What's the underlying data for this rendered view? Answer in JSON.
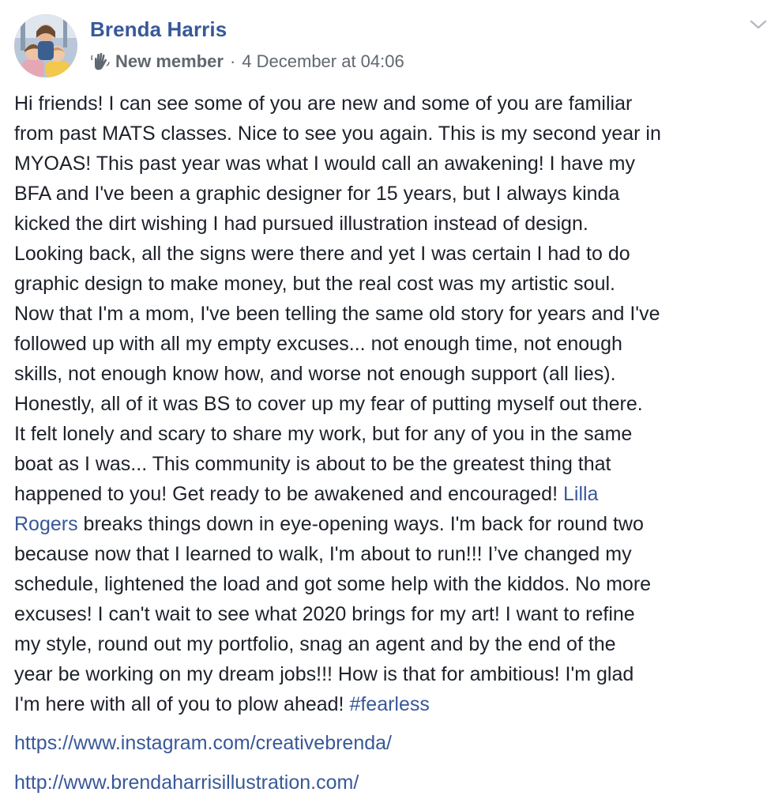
{
  "post": {
    "author": {
      "name": "Brenda Harris",
      "avatar_icon": "profile-photo"
    },
    "meta": {
      "badge_icon": "waving-hand-icon",
      "badge_label": "New member",
      "separator": "·",
      "timestamp": "4 December at 04:06"
    },
    "menu_icon": "chevron-down-icon",
    "lines": [
      {
        "segments": [
          {
            "t": "Hi friends! I can see some of you are new and some of you are familiar"
          }
        ]
      },
      {
        "segments": [
          {
            "t": "from past MATS classes. Nice to see you again. This is my second year in"
          }
        ]
      },
      {
        "segments": [
          {
            "t": "MYOAS! This past year was what I would call an awakening! I have my"
          }
        ]
      },
      {
        "segments": [
          {
            "t": "BFA and I've been a graphic designer for 15 years, but I always kinda"
          }
        ]
      },
      {
        "segments": [
          {
            "t": "kicked the dirt wishing I had pursued illustration instead of design."
          }
        ]
      },
      {
        "segments": [
          {
            "t": "Looking back, all the signs were there and yet I was certain I had to do"
          }
        ]
      },
      {
        "segments": [
          {
            "t": "graphic design to make money, but the real cost was my artistic soul."
          }
        ]
      },
      {
        "segments": [
          {
            "t": "Now that I'm a mom, I've been telling the same old story for years and I've"
          }
        ]
      },
      {
        "segments": [
          {
            "t": "followed up with all my empty excuses... not enough time, not enough"
          }
        ]
      },
      {
        "segments": [
          {
            "t": "skills, not enough know how, and worse not enough support (all lies)."
          }
        ]
      },
      {
        "segments": [
          {
            "t": "Honestly, all of it was BS to cover up my fear of putting myself out there."
          }
        ]
      },
      {
        "segments": [
          {
            "t": "It felt lonely and scary to share my work, but for any of you in the same"
          }
        ]
      },
      {
        "segments": [
          {
            "t": "boat as I was... This community is about to be the greatest thing that"
          }
        ]
      },
      {
        "segments": [
          {
            "t": "happened to you! Get ready to be awakened and encouraged! "
          },
          {
            "t": "Lilla",
            "link": true,
            "name": "mention-lilla-rogers"
          }
        ]
      },
      {
        "segments": [
          {
            "t": "Rogers",
            "link": true,
            "name": "mention-lilla-rogers-cont"
          },
          {
            "t": " breaks things down in eye-opening ways. I'm back for round two"
          }
        ]
      },
      {
        "segments": [
          {
            "t": "because now that I learned to walk, I'm about to run!!! I’ve changed my"
          }
        ]
      },
      {
        "segments": [
          {
            "t": "schedule, lightened the load and got some help with the kiddos. No more"
          }
        ]
      },
      {
        "segments": [
          {
            "t": "excuses! I can't wait to see what 2020 brings for my art! I want to refine"
          }
        ]
      },
      {
        "segments": [
          {
            "t": "my style, round out my portfolio, snag an agent and by the end of the"
          }
        ]
      },
      {
        "segments": [
          {
            "t": "year be working on my dream jobs!!! How is that for ambitious! I'm glad"
          }
        ]
      },
      {
        "segments": [
          {
            "t": "I'm here with all of you to plow ahead! "
          },
          {
            "t": "#fearless",
            "link": true,
            "name": "hashtag-fearless"
          }
        ]
      }
    ],
    "links": [
      "https://www.instagram.com/creativebrenda/",
      "http://www.brendaharrisillustration.com/"
    ]
  }
}
